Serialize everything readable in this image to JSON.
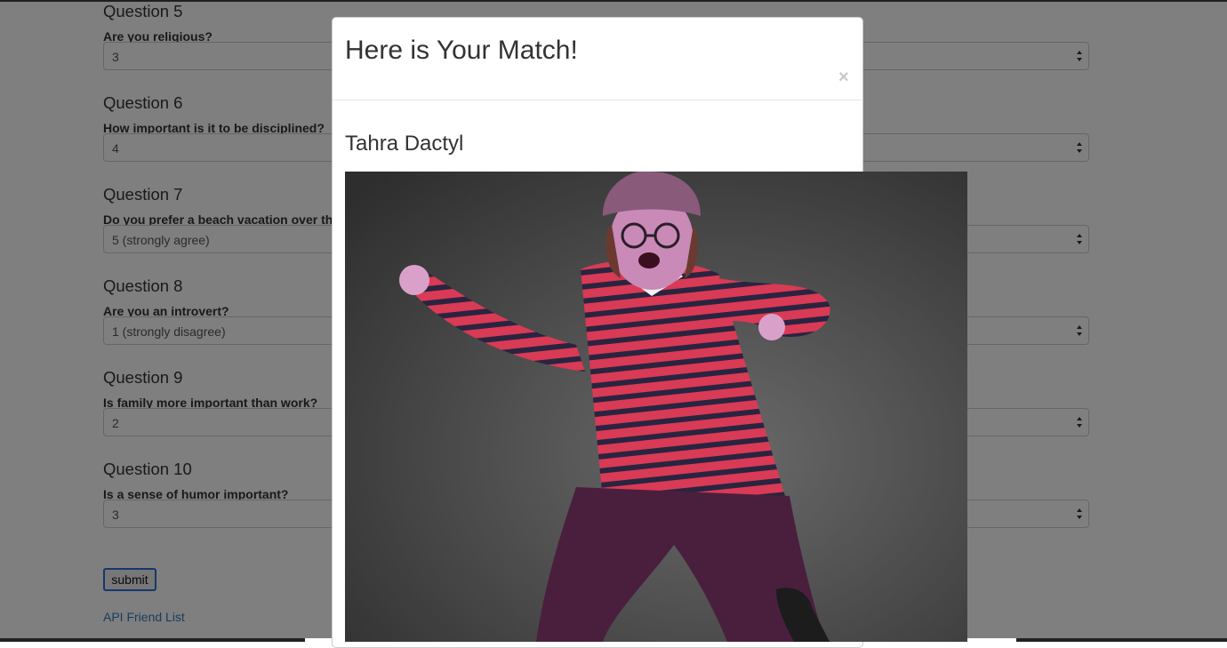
{
  "questions": [
    {
      "title": "Question 5",
      "text": "Are you religious?",
      "value": "3"
    },
    {
      "title": "Question 6",
      "text": "How important is it to be disciplined?",
      "value": "4"
    },
    {
      "title": "Question 7",
      "text": "Do you prefer a beach vacation over th",
      "value": "5 (strongly agree)"
    },
    {
      "title": "Question 8",
      "text": "Are you an introvert?",
      "value": "1 (strongly disagree)"
    },
    {
      "title": "Question 9",
      "text": "Is family more important than work?",
      "value": "2"
    },
    {
      "title": "Question 10",
      "text": "Is a sense of humor important?",
      "value": "3"
    }
  ],
  "form": {
    "submit_label": "submit",
    "api_link": "API Friend List"
  },
  "modal": {
    "title": "Here is Your Match!",
    "close": "×",
    "match_name": "Tahra Dactyl"
  },
  "colors": {
    "link": "#337ab7",
    "backdrop": "rgba(0,0,0,0.5)",
    "shirt_red": "#d93a55",
    "shirt_stripe": "#2a2440",
    "pants": "#4a1f3e",
    "hat": "#8a5a7a"
  }
}
